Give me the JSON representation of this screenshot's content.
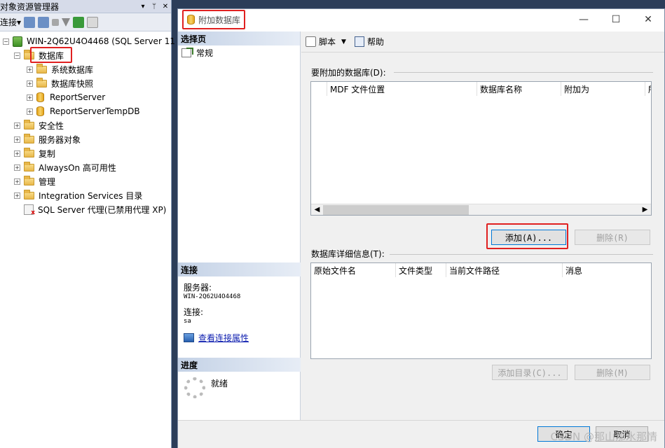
{
  "object_explorer": {
    "title": "对象资源管理器",
    "pin": "▾ ᛘ ✕",
    "connect_label": "连接▾",
    "tree": {
      "server": "WIN-2Q62U4O4468 (SQL Server 11",
      "databases": "数据库",
      "children": [
        {
          "label": "系统数据库",
          "icon": "folder-icon"
        },
        {
          "label": "数据库快照",
          "icon": "folder-icon"
        },
        {
          "label": "ReportServer",
          "icon": "database-icon"
        },
        {
          "label": "ReportServerTempDB",
          "icon": "database-icon"
        }
      ],
      "top_items": [
        {
          "label": "安全性"
        },
        {
          "label": "服务器对象"
        },
        {
          "label": "复制"
        },
        {
          "label": "AlwaysOn 高可用性"
        },
        {
          "label": "管理"
        },
        {
          "label": "Integration Services 目录"
        }
      ],
      "agent": "SQL Server 代理(已禁用代理 XP)"
    }
  },
  "dialog": {
    "title": "附加数据库",
    "window_buttons": {
      "minimize": "—",
      "maximize": "☐",
      "close": "✕"
    },
    "select_page": {
      "header": "选择页",
      "items": [
        {
          "label": "常规"
        }
      ]
    },
    "connection": {
      "header": "连接",
      "server_label": "服务器:",
      "server_value": "WIN-2Q62U4O4468",
      "conn_label": "连接:",
      "conn_value": "sa",
      "link": "查看连接属性"
    },
    "progress": {
      "header": "进度",
      "status": "就绪"
    },
    "toolbar": {
      "script": "脚本",
      "help": "帮助"
    },
    "attach_group": {
      "label": "要附加的数据库(D):",
      "columns": [
        "MDF 文件位置",
        "数据库名称",
        "附加为",
        "所"
      ],
      "add_button": "添加(A)...",
      "remove_button": "删除(R)"
    },
    "details_group": {
      "label": "数据库详细信息(T):",
      "columns": [
        "原始文件名",
        "文件类型",
        "当前文件路径",
        "消息"
      ],
      "add_catalog_button": "添加目录(C)...",
      "remove_button": "删除(M)"
    },
    "footer": {
      "ok": "确定",
      "cancel": "取消",
      "watermark": "CSDN @那山那水那情"
    }
  },
  "colors": {
    "highlight": "#e02020",
    "section_header": "#c4d2e6",
    "background": "#2b3d59"
  }
}
